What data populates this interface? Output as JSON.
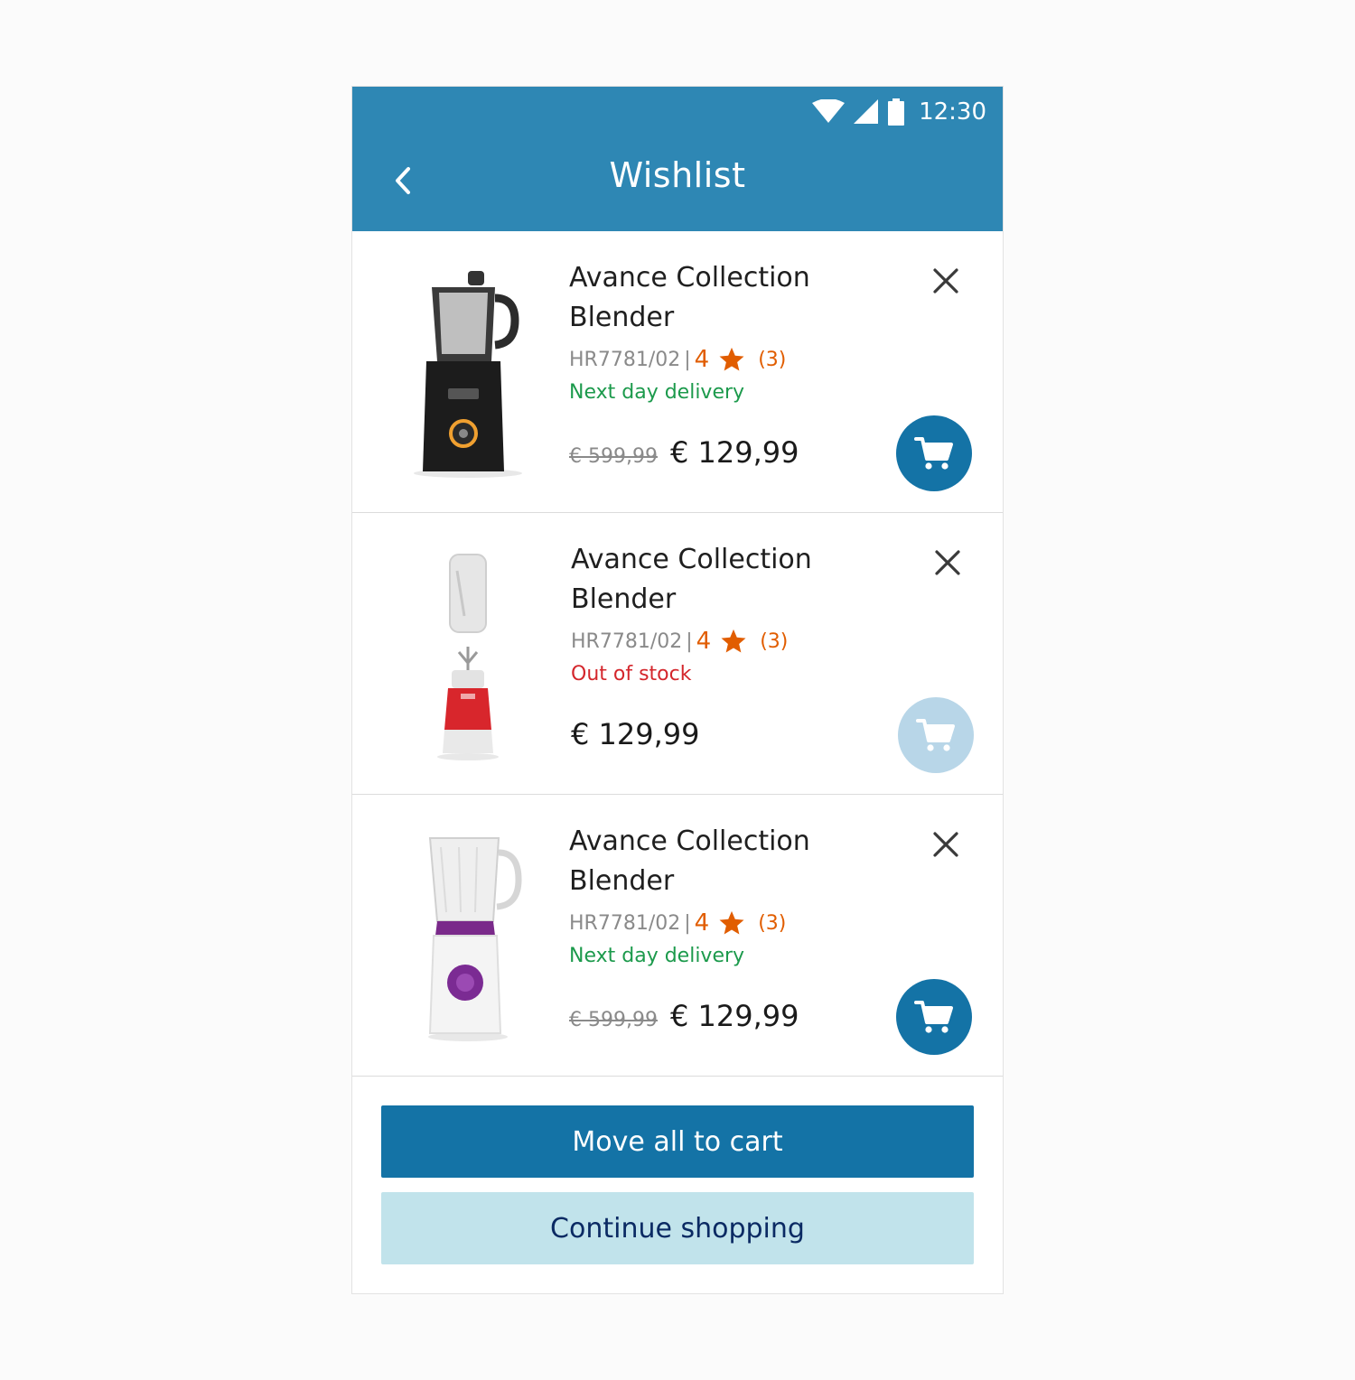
{
  "status_bar": {
    "time": "12:30",
    "icons": [
      "wifi-icon",
      "signal-icon",
      "battery-icon"
    ]
  },
  "header": {
    "title": "Wishlist",
    "back_icon": "chevron-left-icon"
  },
  "items": [
    {
      "name": "Avance Collection Blender",
      "sku": "HR7781/02",
      "separator": "|",
      "rating": "4",
      "reviews": "(3)",
      "availability": "Next day delivery",
      "availability_status": "in-stock",
      "old_price": "€ 599,99",
      "price": "€ 129,99",
      "cart_enabled": true,
      "image": "black-blender"
    },
    {
      "name": "Avance Collection Blender",
      "sku": "HR7781/02",
      "separator": "|",
      "rating": "4",
      "reviews": "(3)",
      "availability": "Out of stock",
      "availability_status": "out-of-stock",
      "old_price": "",
      "price": "€ 129,99",
      "cart_enabled": false,
      "image": "red-portable-blender"
    },
    {
      "name": "Avance Collection Blender",
      "sku": "HR7781/02",
      "separator": "|",
      "rating": "4",
      "reviews": "(3)",
      "availability": "Next day delivery",
      "availability_status": "in-stock",
      "old_price": "€ 599,99",
      "price": "€ 129,99",
      "cart_enabled": true,
      "image": "purple-blender"
    }
  ],
  "actions": {
    "move_all_label": "Move all to cart",
    "continue_label": "Continue shopping"
  },
  "colors": {
    "app_bar": "#2e87b4",
    "primary": "#1473a6",
    "primary_disabled": "#b8d6e8",
    "secondary": "#c1e3eb",
    "rating": "#e15d00",
    "in_stock": "#1c9a4c",
    "out_of_stock": "#d4262c"
  }
}
